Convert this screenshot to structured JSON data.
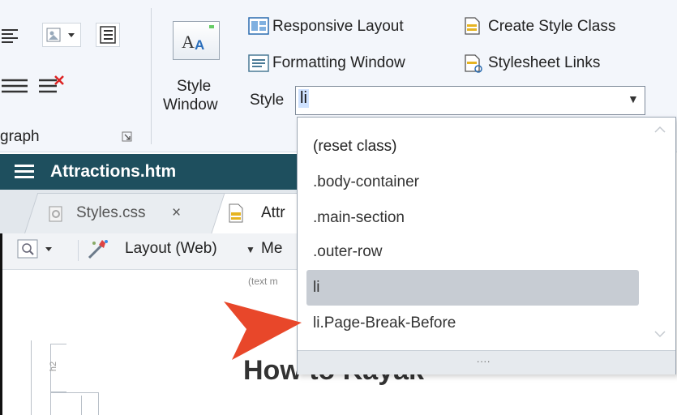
{
  "ribbon": {
    "paragraph_group_label": "graph",
    "style_window_label_line1": "Style",
    "style_window_label_line2": "Window",
    "responsive_layout": "Responsive Layout",
    "formatting_window": "Formatting Window",
    "create_style_class": "Create Style Class",
    "stylesheet_links": "Stylesheet Links",
    "style_label": "Style",
    "style_value": "li"
  },
  "document": {
    "title": "Attractions.htm",
    "tabs": [
      {
        "label": "Styles.css",
        "close": "×"
      },
      {
        "label": "Attr"
      }
    ],
    "toolbar": {
      "layout_label": "Layout (Web)",
      "more_label": "Me"
    },
    "hint_text": "(text m",
    "heading": "How to Kayak",
    "margin_marker": "h2"
  },
  "dropdown": {
    "items": [
      "(reset class)",
      ".body-container",
      ".main-section",
      ".outer-row",
      "li",
      "li.Page-Break-Before"
    ],
    "selected_index": 4,
    "grip": "...."
  },
  "colors": {
    "title_bar": "#1e4f5e",
    "arrow": "#e8472a",
    "selected_item": "#c7ccd3"
  }
}
